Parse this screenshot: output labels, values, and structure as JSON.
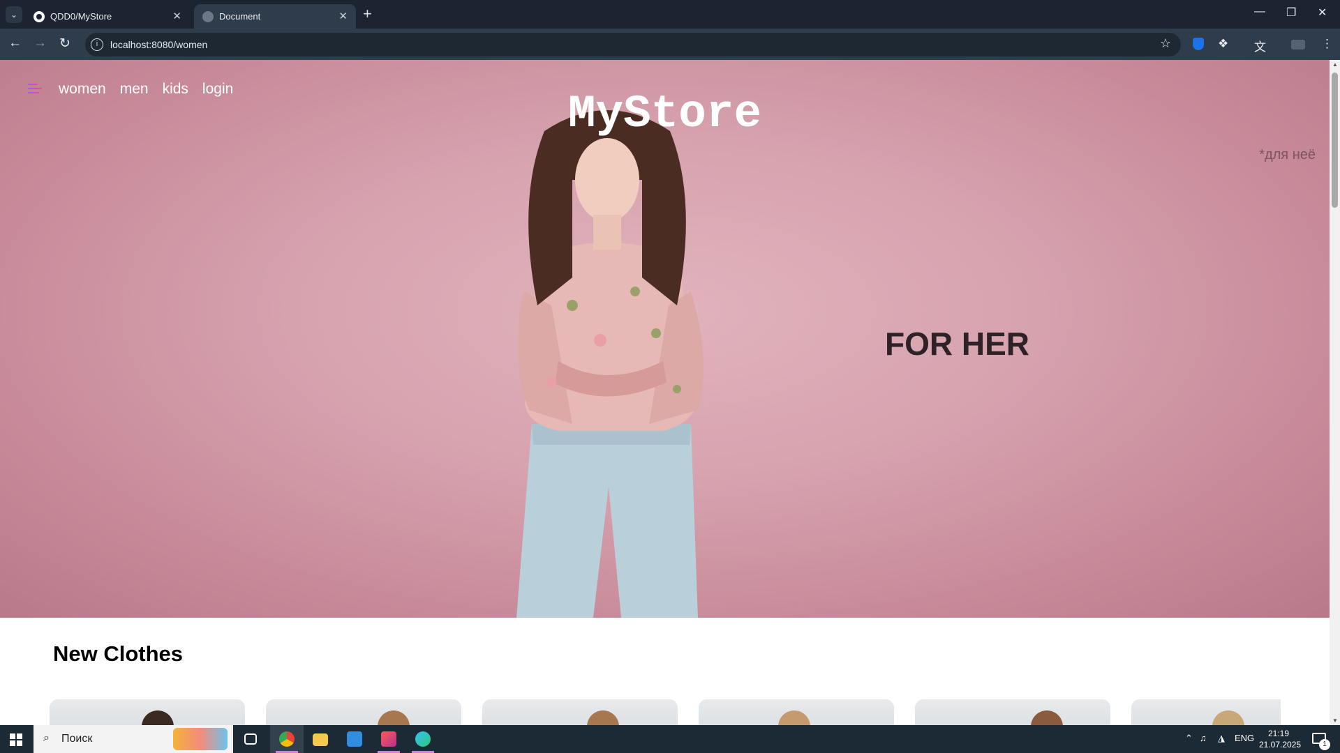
{
  "browser": {
    "tabs": [
      {
        "title": "QDD0/MyStore"
      },
      {
        "title": "Document"
      }
    ],
    "url": "localhost:8080/women"
  },
  "site": {
    "nav": [
      "women",
      "men",
      "kids",
      "login"
    ],
    "logo": "MyStore",
    "tagline": "*для неё",
    "hero_heading": "FOR HER",
    "section_title": "New Clothes",
    "card_count": 6
  },
  "taskbar": {
    "search_placeholder": "Поиск",
    "language": "ENG",
    "time": "21:19",
    "date": "21.07.2025",
    "notification_count": "1"
  },
  "colors": {
    "hero_pink": "#d6a2ae",
    "burger_gradient_start": "#9b5cf6",
    "burger_gradient_end": "#ec4899",
    "browser_dark": "#1b2430"
  },
  "icons": [
    "github-icon",
    "globe-icon",
    "search-icon",
    "star-icon",
    "extensions-icon",
    "translate-icon",
    "menu-icon",
    "windows-icon",
    "chrome-icon",
    "folder-icon",
    "vscode-icon",
    "intellij-icon",
    "edge-icon"
  ]
}
